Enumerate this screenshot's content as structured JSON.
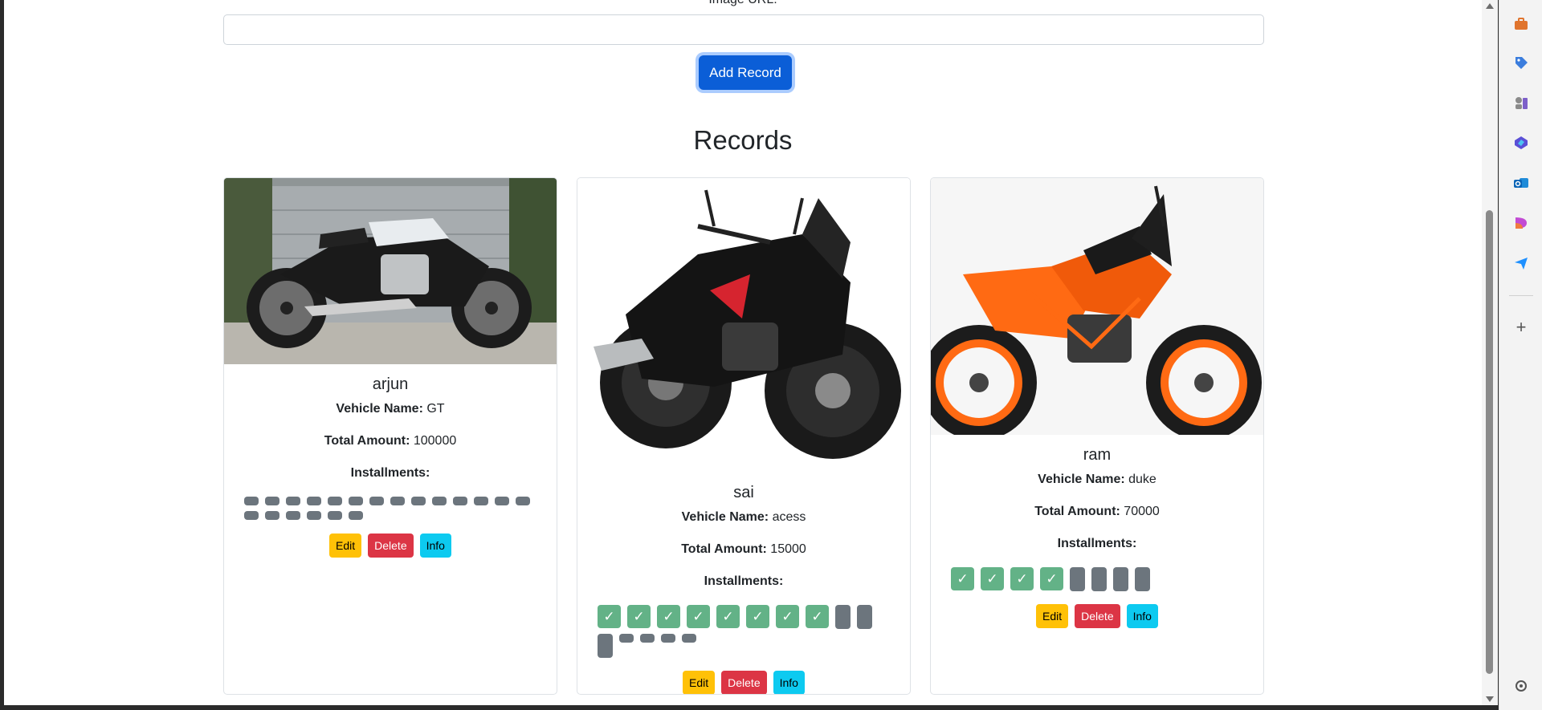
{
  "form": {
    "image_url_label": "Image URL:",
    "image_url_value": "",
    "add_button_label": "Add Record"
  },
  "records_title": "Records",
  "cards": [
    {
      "name": "arjun",
      "vehicle_label": "Vehicle Name:",
      "vehicle_name": "GT",
      "amount_label": "Total Amount:",
      "total_amount": "100000",
      "installments_label": "Installments:",
      "installments_paid": 0,
      "installments_total": 20,
      "image_desc": "black and silver cafe racer motorcycle in front of garage",
      "edit_label": "Edit",
      "delete_label": "Delete",
      "info_label": "Info"
    },
    {
      "name": "sai",
      "vehicle_label": "Vehicle Name:",
      "vehicle_name": "acess",
      "amount_label": "Total Amount:",
      "total_amount": "15000",
      "installments_label": "Installments:",
      "installments_paid": 8,
      "installments_total": 15,
      "image_desc": "black and red sport motorcycle",
      "edit_label": "Edit",
      "delete_label": "Delete",
      "info_label": "Info"
    },
    {
      "name": "ram",
      "vehicle_label": "Vehicle Name:",
      "vehicle_name": "duke",
      "amount_label": "Total Amount:",
      "total_amount": "70000",
      "installments_label": "Installments:",
      "installments_paid": 4,
      "installments_total": 8,
      "image_desc": "orange naked street motorcycle",
      "edit_label": "Edit",
      "delete_label": "Delete",
      "info_label": "Info"
    }
  ],
  "installment_check_glyph": "✓",
  "side_icons": [
    "briefcase-icon",
    "tag-icon",
    "chess-icon",
    "copilot-icon",
    "outlook-icon",
    "designer-icon",
    "send-icon",
    "plus-icon",
    "settings-icon"
  ],
  "colors": {
    "primary": "#0b5ed7",
    "paid": "#63b287",
    "unpaid": "#6c757d",
    "edit": "#ffc107",
    "delete": "#dc3545",
    "info": "#0dcaf0"
  }
}
